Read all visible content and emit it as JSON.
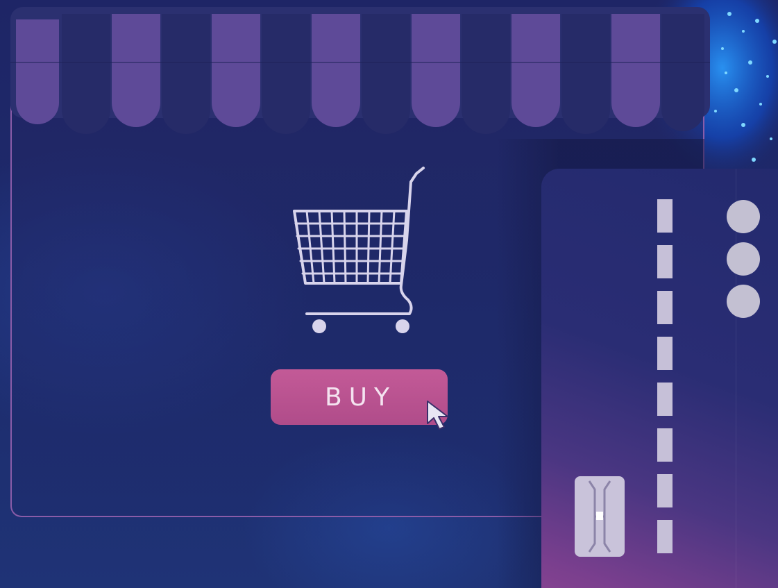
{
  "buy_button": {
    "label": "BUY"
  },
  "icons": {
    "cart": "shopping-cart-icon",
    "pointer": "mouse-pointer-icon",
    "chip": "card-chip-icon",
    "awning": "store-awning"
  },
  "colors": {
    "background": "#1c2462",
    "awning_light": "#5e4a98",
    "awning_dark": "#2b3070",
    "button": "#c35a97",
    "button_text": "#f4e3f0",
    "outline": "#8a5ca8",
    "card_accent": "#8c4592",
    "sparkle": "#1e7cf0"
  }
}
